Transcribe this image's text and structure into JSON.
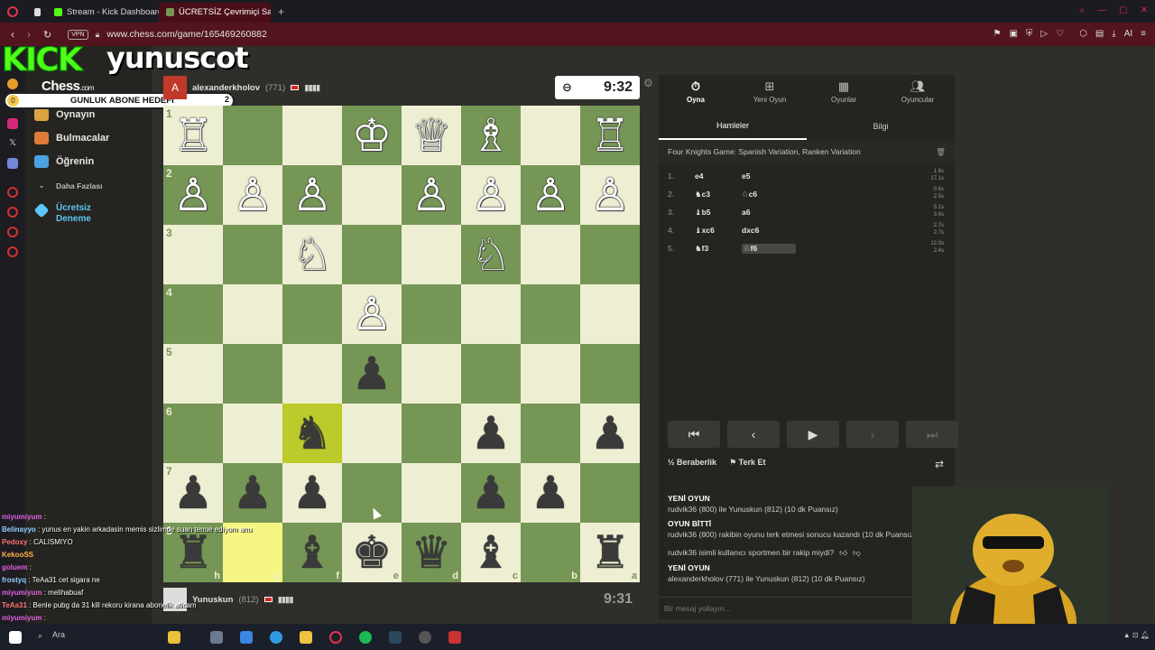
{
  "browser": {
    "tabs": [
      {
        "label": "",
        "color": "#e0e0e0"
      },
      {
        "label": "Stream - Kick Dashboard",
        "color": "#53fc18"
      },
      {
        "label": "ÜCRETSİZ Çevrimiçi Satra",
        "color": "#769656"
      }
    ],
    "new_tab": "+",
    "vpn": "VPN",
    "url": "www.chess.com/game/165469260882"
  },
  "kick": {
    "logo": "KICK",
    "username": "yunuscot",
    "sub_goal": {
      "current": "0",
      "label": "GUNLUK ABONE HEDEFI",
      "target": "2"
    }
  },
  "chess_nav": {
    "logo": "Chess",
    "logo_suffix": ".com",
    "items": [
      {
        "label": "Oynayın",
        "color": "#d9a441"
      },
      {
        "label": "Bulmacalar",
        "color": "#e07b39"
      },
      {
        "label": "Öğrenin",
        "color": "#4aa3df"
      },
      {
        "label": "Daha Fazlası",
        "color": "#999999"
      },
      {
        "label": "Ücretsiz Deneme",
        "color": "#5bc8f5"
      }
    ]
  },
  "players": {
    "top": {
      "avatar": "A",
      "name": "alexanderkholov",
      "rating": "(771)",
      "clock": "9:32"
    },
    "bottom": {
      "name": "Yunuskun",
      "rating": "(812)",
      "clock": "9:31"
    }
  },
  "board": {
    "rank_labels": [
      "1",
      "2",
      "3",
      "4",
      "5",
      "6",
      "7",
      "8"
    ],
    "file_labels": [
      "h",
      "g",
      "f",
      "e",
      "d",
      "c",
      "b",
      "a"
    ],
    "pieces": [
      [
        "wR",
        "",
        "",
        "wK",
        "wQ",
        "wB",
        "",
        "wR"
      ],
      [
        "wP",
        "wP",
        "wP",
        "",
        "wP",
        "wP",
        "wP",
        "wP"
      ],
      [
        "",
        "",
        "wN",
        "",
        "",
        "wN",
        "",
        ""
      ],
      [
        "",
        "",
        "",
        "wP",
        "",
        "",
        "",
        ""
      ],
      [
        "",
        "",
        "",
        "bP",
        "",
        "",
        "",
        ""
      ],
      [
        "",
        "",
        "bN",
        "",
        "",
        "bP",
        "",
        "bP"
      ],
      [
        "bP",
        "bP",
        "bP",
        "",
        "",
        "bP",
        "bP",
        ""
      ],
      [
        "bR",
        "",
        "bB",
        "bK",
        "bQ",
        "bB",
        "",
        "bR"
      ]
    ],
    "highlights": [
      "5-2",
      "7-1"
    ]
  },
  "panel": {
    "tabs": [
      {
        "label": "Oyna",
        "icon": "clock-icon"
      },
      {
        "label": "Yeni Oyun",
        "icon": "plus-icon"
      },
      {
        "label": "Oyunlar",
        "icon": "board-icon"
      },
      {
        "label": "Oyuncular",
        "icon": "players-icon"
      }
    ],
    "subtabs": [
      "Hamleler",
      "Bilgi"
    ],
    "opening": "Four Knights Game: Spanish Variation, Ranken Variation",
    "moves": [
      {
        "n": "1.",
        "w": "e4",
        "b": "e5",
        "wt": "1.6s",
        "bt": "17.1s"
      },
      {
        "n": "2.",
        "w": "♞c3",
        "b": "♘c6",
        "wt": "0.6s",
        "bt": "2.5s"
      },
      {
        "n": "3.",
        "w": "♝b5",
        "b": "a6",
        "wt": "5.1s",
        "bt": "3.4s"
      },
      {
        "n": "4.",
        "w": "♝xc6",
        "b": "dxc6",
        "wt": "2.7s",
        "bt": "2.7s"
      },
      {
        "n": "5.",
        "w": "♞f3",
        "b": "♘f6",
        "wt": "12.0s",
        "bt": "2.4s"
      }
    ],
    "draw": "Beraberlik",
    "resign": "Terk Et",
    "chat_log": [
      {
        "head": "YENİ OYUN",
        "line": "rudvik36 (800) ile Yunuskun (812) (10 dk Puansız)"
      },
      {
        "head": "OYUN BİTTİ",
        "line": "rudvik36 (800) rakibin oyunu terk etmesi sonucu kazandı (10 dk Puansız)"
      },
      {
        "head": "",
        "line": "rudvik36 isimli kullanıcı sportmen bir rakip miydi?"
      },
      {
        "head": "YENİ OYUN",
        "line": "alexanderkholov (771) ile Yunuskun (812) (10 dk Puansız)"
      }
    ],
    "message_placeholder": "Bir mesaj yollayın..."
  },
  "stream_chat": [
    {
      "user": "miyumiyum",
      "text": ":",
      "color": "#e060e0"
    },
    {
      "user": "Belinayyo",
      "text": ": yunus en yakin arkadasin memis sizlimde suan tenue ediyom anu",
      "color": "#8fd0ff"
    },
    {
      "user": "Pedoxy",
      "text": ": CALISMIYO",
      "color": "#ff7070"
    },
    {
      "user": "KekooSS",
      "text": "",
      "color": "#ffb347"
    },
    {
      "user": "goluem",
      "text": ":",
      "color": "#e060e0"
    },
    {
      "user": "frostyq",
      "text": ": TeAa31 cet sigara ne",
      "color": "#8fd0ff"
    },
    {
      "user": "miyumiyum",
      "text": ": melihabuaf",
      "color": "#e060e0"
    },
    {
      "user": "TeAa31",
      "text": ": Benle pubg da 31 kill rekoru kirana abonelik aticam",
      "color": "#ff7070"
    },
    {
      "user": "miyumiyum",
      "text": ":",
      "color": "#e060e0"
    }
  ],
  "taskbar": {
    "search": "Ara"
  }
}
